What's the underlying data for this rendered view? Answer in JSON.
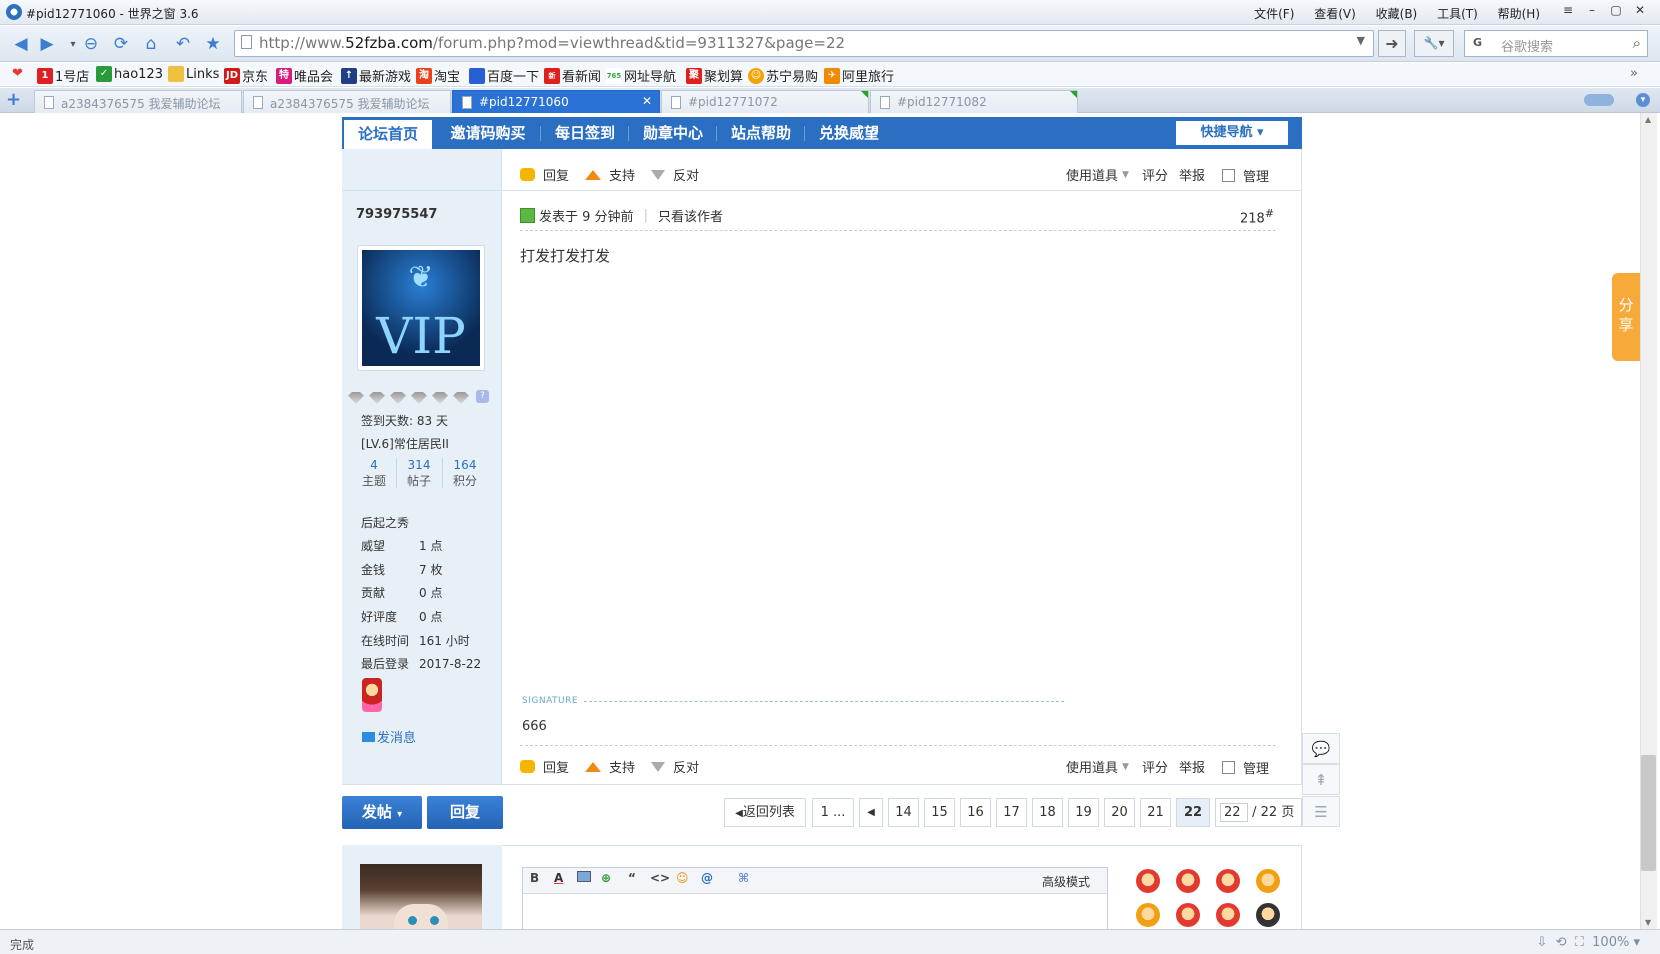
{
  "browser": {
    "title": "#pid12771060 - 世界之窗 3.6",
    "menu": [
      "文件(F)",
      "查看(V)",
      "收藏(B)",
      "工具(T)",
      "帮助(H)"
    ],
    "url_host_prefix": "http://www.",
    "url_host": "52fzba.com",
    "url_path": "/forum.php?mod=viewthread&tid=9311327&page=22",
    "search_placeholder": "谷歌搜索",
    "search_engine": "G",
    "favorites": [
      "1号店",
      "hao123",
      "Links",
      "京东",
      "唯品会",
      "最新游戏",
      "淘宝",
      "百度一下",
      "看新闻",
      "网址导航",
      "聚划算",
      "苏宁易购",
      "阿里旅行"
    ],
    "tabs": [
      {
        "label": "a2384376575 我爱辅助论坛",
        "active": false
      },
      {
        "label": "a2384376575 我爱辅助论坛",
        "active": false
      },
      {
        "label": "#pid12771060",
        "active": true
      },
      {
        "label": "#pid12771072",
        "active": false
      },
      {
        "label": "#pid12771082",
        "active": false
      }
    ],
    "status_text": "完成",
    "zoom": "100%"
  },
  "forum": {
    "nav": [
      "论坛首页",
      "邀请码购买",
      "每日签到",
      "勋章中心",
      "站点帮助",
      "兑换威望"
    ],
    "quicknav": "快捷导航",
    "actions": {
      "reply": "回复",
      "support": "支持",
      "oppose": "反对",
      "tools": "使用道具",
      "rate": "评分",
      "report": "举报",
      "manage": "管理"
    },
    "post": {
      "author": "793975547",
      "posted_label": "发表于",
      "posted_time": "9 分钟前",
      "only_author": "只看该作者",
      "floor": "218",
      "floor_sup": "#",
      "content": "打发打发打发",
      "signature_label": "SIGNATURE",
      "signature": "666"
    },
    "profile": {
      "vip_text": "VIP",
      "checkin": "签到天数: 83 天",
      "level": "[LV.6]常住居民II",
      "stats": [
        {
          "n": "4",
          "l": "主题"
        },
        {
          "n": "314",
          "l": "帖子"
        },
        {
          "n": "164",
          "l": "积分"
        }
      ],
      "group": "后起之秀",
      "fields": [
        {
          "k": "威望",
          "v": "1 点"
        },
        {
          "k": "金钱",
          "v": "7 枚"
        },
        {
          "k": "贡献",
          "v": "0 点"
        },
        {
          "k": "好评度",
          "v": "0 点"
        },
        {
          "k": "在线时间",
          "v": "161 小时"
        },
        {
          "k": "最后登录",
          "v": "2017-8-22"
        }
      ],
      "message": "发消息"
    },
    "buttons": {
      "new_post": "发帖",
      "reply": "回复"
    },
    "pagination": {
      "back": "返回列表",
      "first": "1 ...",
      "pages": [
        "14",
        "15",
        "16",
        "17",
        "18",
        "19",
        "20",
        "21",
        "22"
      ],
      "current": "22",
      "input": "22",
      "total": "/ 22 页"
    },
    "editor": {
      "advanced": "高级模式",
      "tools": [
        "B",
        "A",
        "img",
        "link",
        "“",
        "<>",
        "☺",
        "@",
        "📎"
      ]
    },
    "share": "分享"
  }
}
